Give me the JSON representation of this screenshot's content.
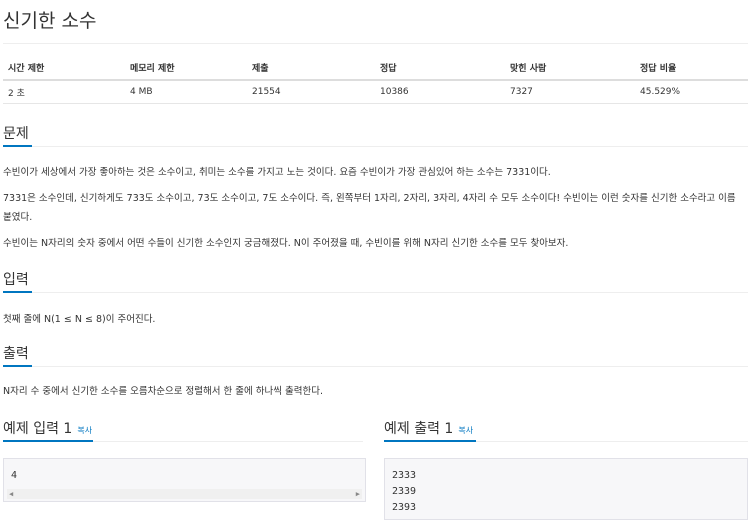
{
  "problem": {
    "title": "신기한 소수"
  },
  "info_table": {
    "headers": [
      "시간 제한",
      "메모리 제한",
      "제출",
      "정답",
      "맞힌 사람",
      "정답 비율"
    ],
    "row": [
      "2 초",
      "4 MB",
      "21554",
      "10386",
      "7327",
      "45.529%"
    ]
  },
  "sections": {
    "description": {
      "heading": "문제",
      "paragraphs": [
        "수빈이가 세상에서 가장 좋아하는 것은 소수이고, 취미는 소수를 가지고 노는 것이다. 요즘 수빈이가 가장 관심있어 하는 소수는 7331이다.",
        "7331은 소수인데, 신기하게도 733도 소수이고, 73도 소수이고, 7도 소수이다. 즉, 왼쪽부터 1자리, 2자리, 3자리, 4자리 수 모두 소수이다! 수빈이는 이런 숫자를 신기한 소수라고 이름 붙였다.",
        "수빈이는 N자리의 숫자 중에서 어떤 수들이 신기한 소수인지 궁금해졌다. N이 주어졌을 때, 수빈이를 위해 N자리 신기한 소수를 모두 찾아보자."
      ]
    },
    "input": {
      "heading": "입력",
      "text": "첫째 줄에 N(1 ≤ N ≤ 8)이 주어진다."
    },
    "output": {
      "heading": "출력",
      "text": "N자리 수 중에서 신기한 소수를 오름차순으로 정렬해서 한 줄에 하나씩 출력한다."
    }
  },
  "samples": {
    "input": {
      "heading": "예제 입력 1",
      "copy_label": "복사",
      "content": "4"
    },
    "output": {
      "heading": "예제 출력 1",
      "copy_label": "복사",
      "content": "2333\n2339\n2393"
    }
  },
  "icons": {
    "scroll_left": "caret-left-icon",
    "scroll_right": "caret-right-icon"
  },
  "colors": {
    "accent": "#0076c0",
    "sample_bg": "#f7f7f9"
  }
}
